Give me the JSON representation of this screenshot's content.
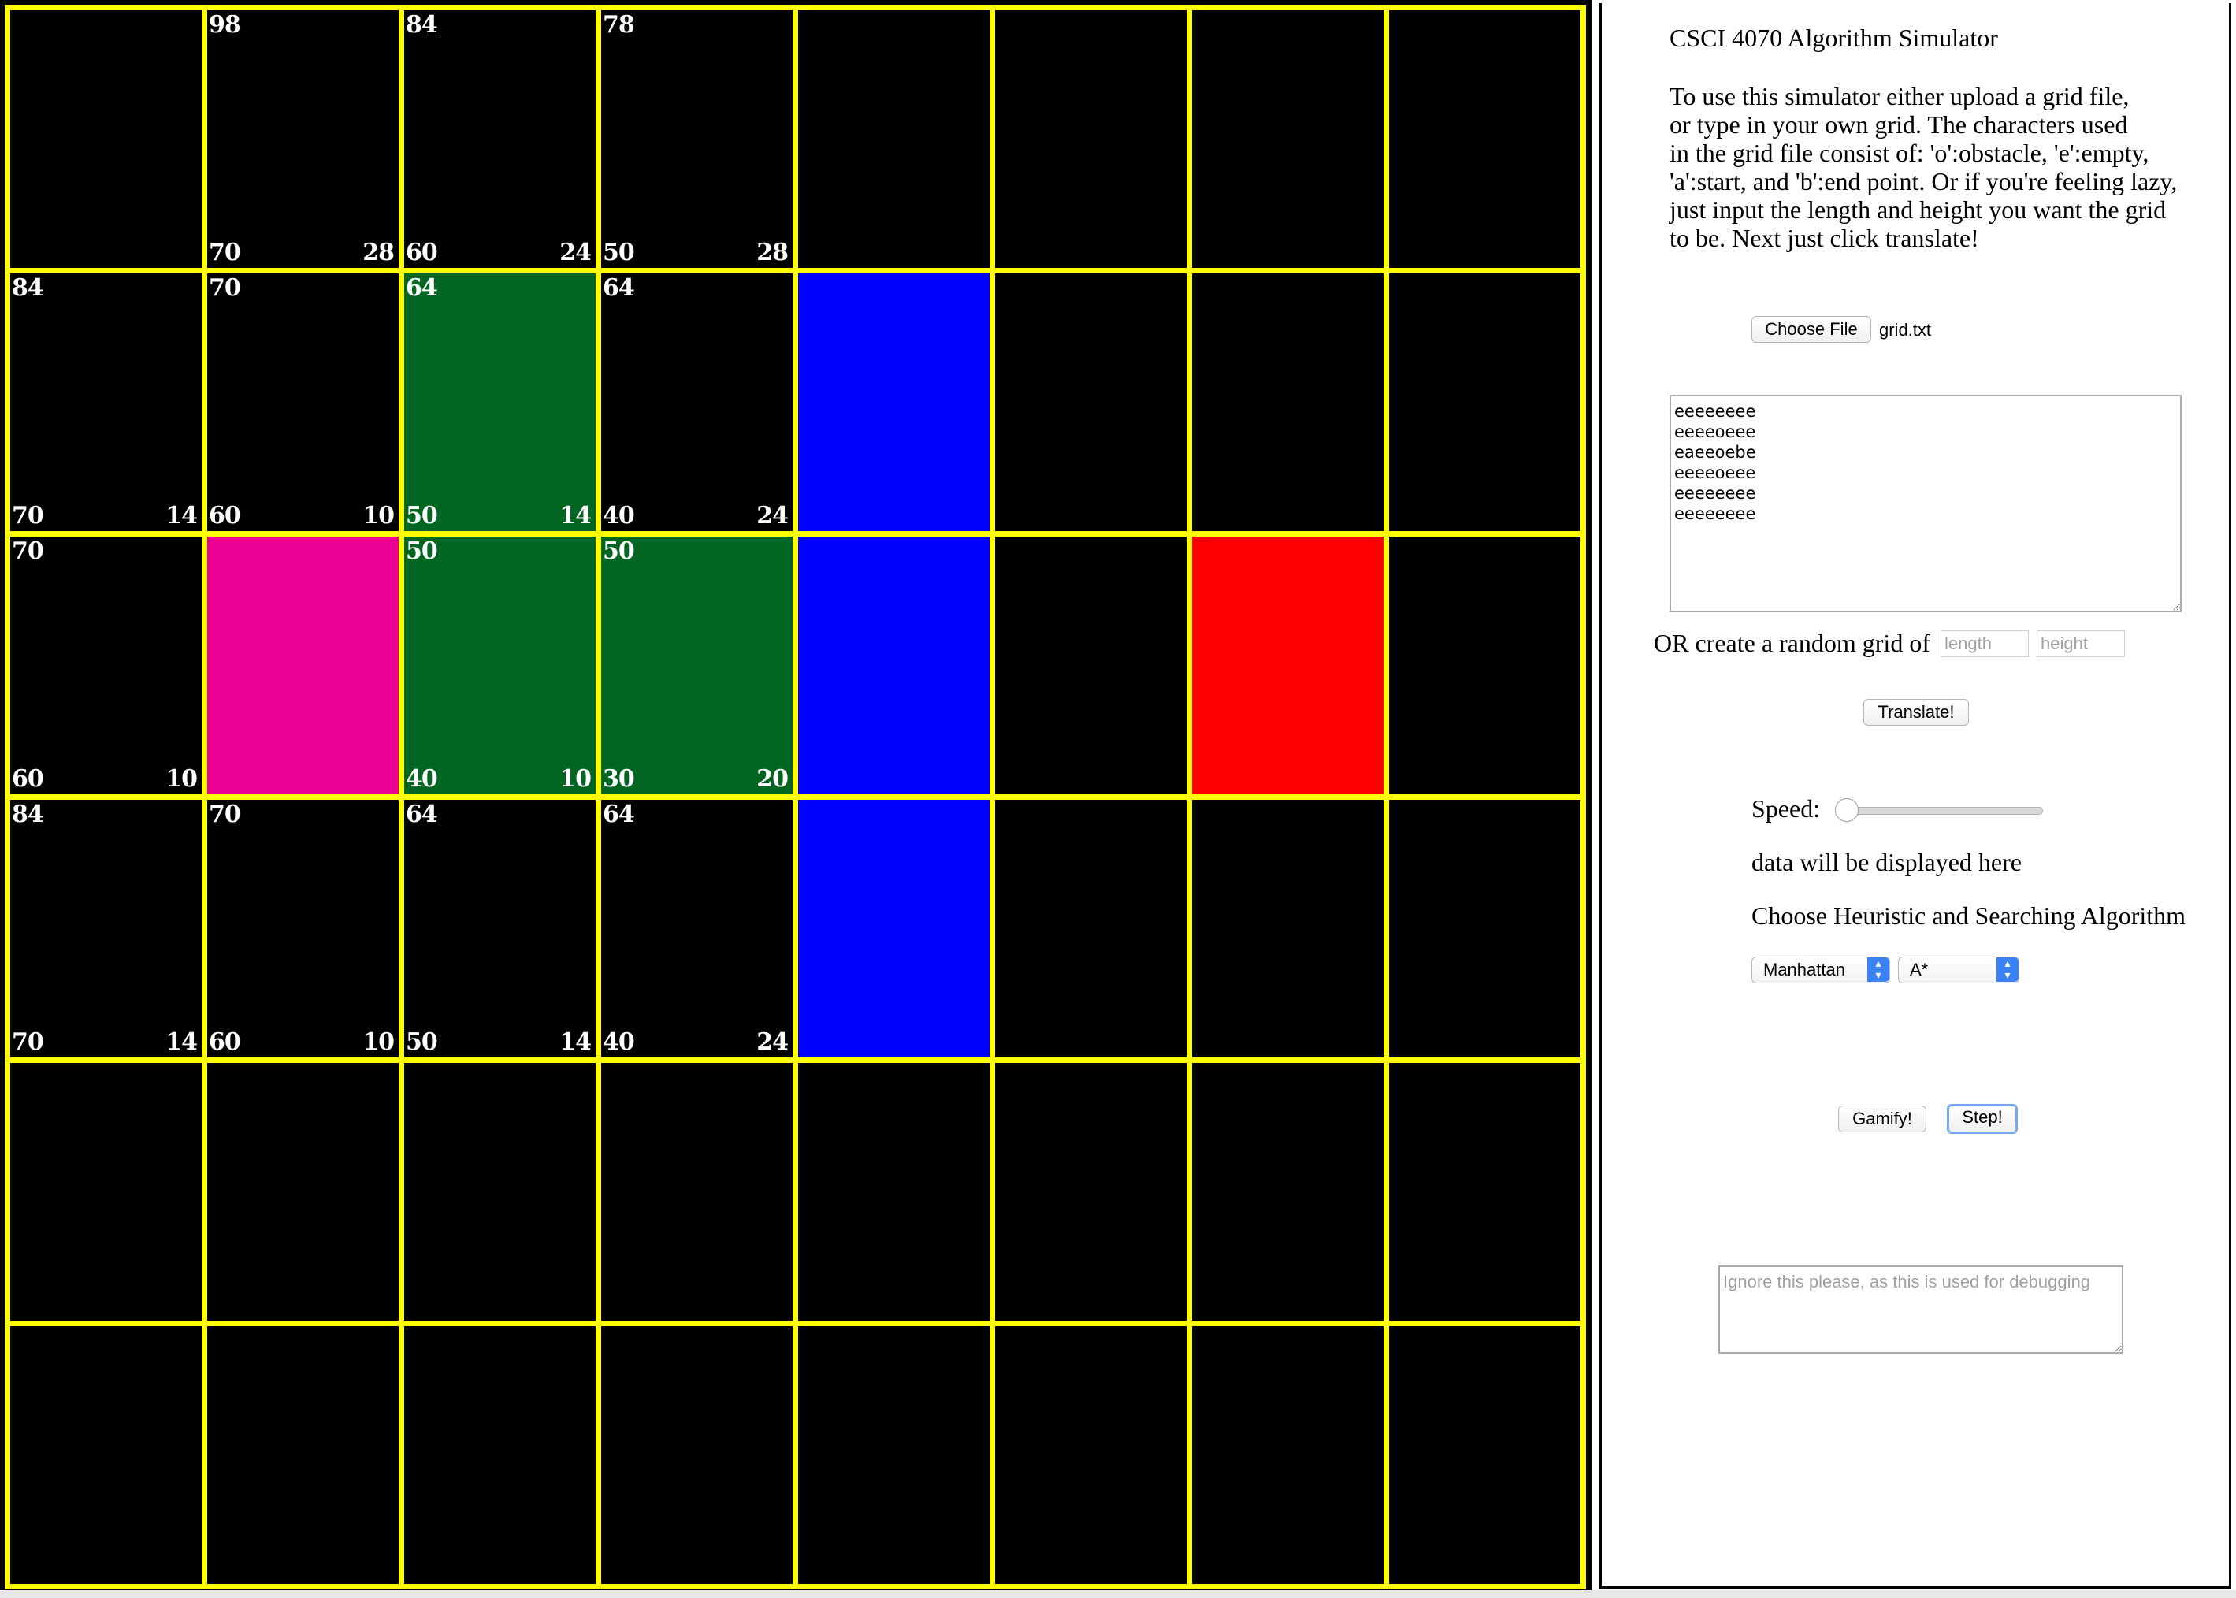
{
  "grid": {
    "columns": 8,
    "rows": 6,
    "colors": {
      "line": "#ffff00",
      "empty": "#000000",
      "start": "#ec0093",
      "end": "#ff0000",
      "obstacle": "#0000ff",
      "visited": "#006621"
    },
    "filled_cells": [
      {
        "row": 1,
        "col": 2,
        "type": "visited"
      },
      {
        "row": 1,
        "col": 4,
        "type": "obstacle"
      },
      {
        "row": 2,
        "col": 1,
        "type": "start"
      },
      {
        "row": 2,
        "col": 2,
        "type": "visited"
      },
      {
        "row": 2,
        "col": 3,
        "type": "visited"
      },
      {
        "row": 2,
        "col": 4,
        "type": "obstacle"
      },
      {
        "row": 2,
        "col": 6,
        "type": "end"
      },
      {
        "row": 3,
        "col": 4,
        "type": "obstacle"
      }
    ],
    "cell_scores": [
      {
        "row": 0,
        "col": 1,
        "tl": "98",
        "bl": "70",
        "br": "28"
      },
      {
        "row": 0,
        "col": 2,
        "tl": "84",
        "bl": "60",
        "br": "24"
      },
      {
        "row": 0,
        "col": 3,
        "tl": "78",
        "bl": "50",
        "br": "28"
      },
      {
        "row": 1,
        "col": 0,
        "tl": "84",
        "bl": "70",
        "br": "14"
      },
      {
        "row": 1,
        "col": 1,
        "tl": "70",
        "bl": "60",
        "br": "10"
      },
      {
        "row": 1,
        "col": 2,
        "tl": "64",
        "bl": "50",
        "br": "14"
      },
      {
        "row": 1,
        "col": 3,
        "tl": "64",
        "bl": "40",
        "br": "24"
      },
      {
        "row": 2,
        "col": 0,
        "tl": "70",
        "bl": "60",
        "br": "10"
      },
      {
        "row": 2,
        "col": 2,
        "tl": "50",
        "bl": "40",
        "br": "10"
      },
      {
        "row": 2,
        "col": 3,
        "tl": "50",
        "bl": "30",
        "br": "20"
      },
      {
        "row": 3,
        "col": 0,
        "tl": "84",
        "bl": "70",
        "br": "14"
      },
      {
        "row": 3,
        "col": 1,
        "tl": "70",
        "bl": "60",
        "br": "10"
      },
      {
        "row": 3,
        "col": 2,
        "tl": "64",
        "bl": "50",
        "br": "14"
      },
      {
        "row": 3,
        "col": 3,
        "tl": "64",
        "bl": "40",
        "br": "24"
      }
    ]
  },
  "panel": {
    "title": "CSCI 4070 Algorithm Simulator",
    "instructions": [
      "To use this simulator either upload a grid file,",
      "or type in your own grid. The characters used",
      "in the grid file consist of: 'o':obstacle, 'e':empty,",
      "'a':start, and 'b':end point. Or if you're feeling lazy,",
      "just input the length and height you want the grid",
      "to be. Next just click translate!"
    ],
    "choose_file_label": "Choose File",
    "file_name": "grid.txt",
    "grid_text": "eeeeeeee\neeeeoeee\neaeeoebe\neeeeoeee\neeeeeeee\neeeeeeee",
    "random_label": "OR create a random grid of",
    "length_placeholder": "length",
    "height_placeholder": "height",
    "translate_label": "Translate!",
    "speed_label": "Speed:",
    "speed_value": 0,
    "data_text": "data will be displayed here",
    "choose_label": "Choose Heuristic and Searching Algorithm",
    "heuristic_selected": "Manhattan",
    "algorithm_selected": "A*",
    "gamify_label": "Gamify!",
    "step_label": "Step!",
    "debug_placeholder": "Ignore this please, as this is used for debugging"
  }
}
